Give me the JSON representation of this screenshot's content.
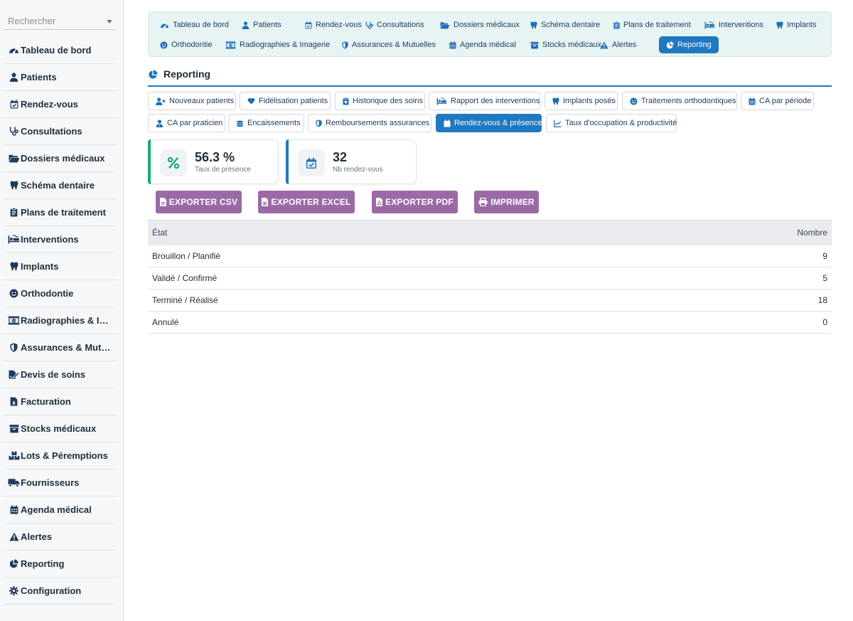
{
  "search": {
    "placeholder": "Rechercher"
  },
  "sidebar": {
    "items": [
      {
        "label": "Tableau de bord",
        "icon": "tachometer-icon"
      },
      {
        "label": "Patients",
        "icon": "user-icon"
      },
      {
        "label": "Rendez-vous",
        "icon": "calendar-check-icon"
      },
      {
        "label": "Consultations",
        "icon": "stethoscope-icon"
      },
      {
        "label": "Dossiers médicaux",
        "icon": "folder-open-icon"
      },
      {
        "label": "Schéma dentaire",
        "icon": "tooth-icon"
      },
      {
        "label": "Plans de traitement",
        "icon": "clipboard-icon"
      },
      {
        "label": "Interventions",
        "icon": "procedures-icon"
      },
      {
        "label": "Implants",
        "icon": "tooth-icon"
      },
      {
        "label": "Orthodontie",
        "icon": "smile-icon"
      },
      {
        "label": "Radiographies & Imagerie",
        "icon": "x-ray-icon"
      },
      {
        "label": "Assurances & Mutuelles",
        "icon": "shield-icon"
      },
      {
        "label": "Devis de soins",
        "icon": "file-signature-icon"
      },
      {
        "label": "Facturation",
        "icon": "invoice-icon"
      },
      {
        "label": "Stocks médicaux",
        "icon": "box-icon"
      },
      {
        "label": "Lots & Péremptions",
        "icon": "boxes-icon"
      },
      {
        "label": "Fournisseurs",
        "icon": "truck-icon"
      },
      {
        "label": "Agenda médical",
        "icon": "calendar-icon"
      },
      {
        "label": "Alertes",
        "icon": "warning-icon"
      },
      {
        "label": "Reporting",
        "icon": "pie-chart-icon"
      },
      {
        "label": "Configuration",
        "icon": "gear-icon"
      }
    ]
  },
  "modules": {
    "row1": [
      {
        "label": "Tableau de bord",
        "icon": "tachometer-icon"
      },
      {
        "label": "Patients",
        "icon": "user-icon"
      },
      {
        "label": "Rendez-vous",
        "icon": "calendar-check-icon"
      },
      {
        "label": "Consultations",
        "icon": "stethoscope-icon"
      },
      {
        "label": "Dossiers médicaux",
        "icon": "folder-open-icon"
      },
      {
        "label": "Schéma dentaire",
        "icon": "tooth-icon"
      },
      {
        "label": "Plans de traitement",
        "icon": "clipboard-icon"
      },
      {
        "label": "Interventions",
        "icon": "procedures-icon"
      },
      {
        "label": "Implants",
        "icon": "tooth-icon"
      }
    ],
    "row2": [
      {
        "label": "Orthodontie",
        "icon": "smile-icon"
      },
      {
        "label": "Radiographies & Imagerie",
        "icon": "x-ray-icon"
      },
      {
        "label": "Assurances & Mutuelles",
        "icon": "shield-icon"
      },
      {
        "label": "Agenda médical",
        "icon": "calendar-icon"
      },
      {
        "label": "Stocks médicaux",
        "icon": "box-icon"
      },
      {
        "label": "Alertes",
        "icon": "warning-icon"
      },
      {
        "label": "Reporting",
        "icon": "pie-chart-icon",
        "active": true
      }
    ]
  },
  "page": {
    "title": "Reporting"
  },
  "reports": {
    "row1": [
      {
        "label": "Nouveaux patients",
        "icon": "user-plus-icon"
      },
      {
        "label": "Fidélisation patients",
        "icon": "heart-icon"
      },
      {
        "label": "Historique des soins",
        "icon": "notes-medical-icon"
      },
      {
        "label": "Rapport des interventions",
        "icon": "procedures-icon"
      },
      {
        "label": "Implants posés",
        "icon": "tooth-icon"
      },
      {
        "label": "Traitements orthodontiques",
        "icon": "smile-icon"
      },
      {
        "label": "CA par période",
        "icon": "calendar-icon"
      }
    ],
    "row2": [
      {
        "label": "CA par praticien",
        "icon": "user-doctor-icon"
      },
      {
        "label": "Encaissements",
        "icon": "coins-icon"
      },
      {
        "label": "Remboursements assurances",
        "icon": "shield-icon"
      },
      {
        "label": "Rendez-vous & présence",
        "icon": "calendar-check-icon",
        "active": true
      },
      {
        "label": "Taux d'occupation & productivité",
        "icon": "chart-line-icon"
      }
    ]
  },
  "kpis": [
    {
      "value": "56.3 %",
      "label": "Taux de présence",
      "icon": "percent-icon",
      "accent": "#1aa77a"
    },
    {
      "value": "32",
      "label": "Nb rendez-vous",
      "icon": "calendar-check-icon",
      "accent": "#1f78c1"
    }
  ],
  "exports": {
    "csv": "EXPORTER CSV",
    "excel": "EXPORTER EXCEL",
    "pdf": "EXPORTER PDF",
    "print": "IMPRIMER"
  },
  "table": {
    "headers": {
      "state": "État",
      "count": "Nombre"
    },
    "rows": [
      {
        "state": "Brouillon / Planifié",
        "count": "9"
      },
      {
        "state": "Validé / Confirmé",
        "count": "5"
      },
      {
        "state": "Terminé / Réalisé",
        "count": "18"
      },
      {
        "state": "Annulé",
        "count": "0"
      }
    ]
  },
  "colors": {
    "primary": "#1f78c1",
    "export": "#9b6aa6",
    "navbg": "#e7f4f3",
    "success": "#1aa77a"
  }
}
